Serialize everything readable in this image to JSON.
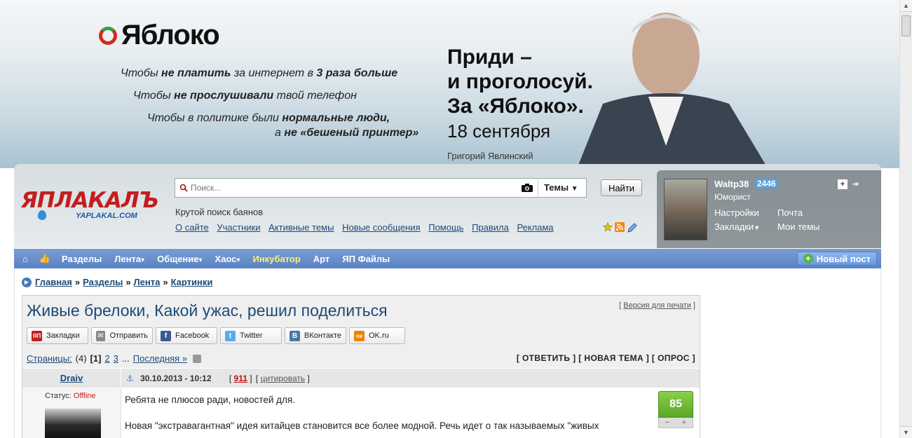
{
  "banner": {
    "brand": "Яблоко",
    "lines": [
      {
        "pre": "Чтобы ",
        "bold": "не платить",
        "mid": " за интернет в ",
        "bold2": "3 раза больше",
        "post": ""
      },
      {
        "pre": "Чтобы ",
        "bold": "не прослушивали",
        "mid": " твой телефон",
        "bold2": "",
        "post": ""
      },
      {
        "pre": "Чтобы в политике были ",
        "bold": "нормальные люди,",
        "mid": "",
        "bold2": "",
        "post": ""
      },
      {
        "pre": "а ",
        "bold": "не «бешеный принтер»",
        "mid": "",
        "bold2": "",
        "post": ""
      }
    ],
    "slogan": [
      "Приди –",
      "и проголосуй.",
      "За «Яблоко»."
    ],
    "date": "18 сентября",
    "author": "Григорий Явлинский"
  },
  "site": {
    "logo_text": "ЯПЛАКАЛЪ",
    "logo_url": "YAPLAKAL.COM"
  },
  "search": {
    "placeholder": "Поиск...",
    "scope": "Темы",
    "button": "Найти",
    "hint": "Крутой поиск баянов"
  },
  "nav_links": [
    "О сайте",
    "Участники",
    "Активные темы",
    "Новые сообщения",
    "Помощь",
    "Правила",
    "Реклама"
  ],
  "profile": {
    "username": "Waltp38",
    "karma": "2446",
    "rank": "Юморист",
    "settings": "Настройки",
    "mail": "Почта",
    "bookmarks": "Закладки",
    "my_topics": "Мои темы"
  },
  "mainnav": {
    "items": [
      {
        "label": "Разделы",
        "arrow": ""
      },
      {
        "label": "Лента",
        "arrow": "▾"
      },
      {
        "label": "Общение",
        "arrow": "▾"
      },
      {
        "label": "Хаос",
        "arrow": "▾"
      },
      {
        "label": "Инкубатор",
        "arrow": ""
      },
      {
        "label": "Арт",
        "arrow": ""
      },
      {
        "label": "ЯП Файлы",
        "arrow": ""
      }
    ],
    "new_post": "Новый пост"
  },
  "breadcrumbs": [
    "Главная",
    "Разделы",
    "Лента",
    "Картинки"
  ],
  "breadcrumb_sep": "»",
  "topic": {
    "title": "Живые брелоки, Какой ужас, решил поделиться",
    "print_link": "Версия для печати"
  },
  "share": [
    {
      "label": "Закладки",
      "icon": "ЯП",
      "color": "#c21e1e"
    },
    {
      "label": "Отправить",
      "icon": "✉",
      "color": "#888888"
    },
    {
      "label": "Facebook",
      "icon": "f",
      "color": "#3b5998"
    },
    {
      "label": "Twitter",
      "icon": "t",
      "color": "#55acee"
    },
    {
      "label": "ВКонтакте",
      "icon": "В",
      "color": "#4a76a8"
    },
    {
      "label": "OK.ru",
      "icon": "ок",
      "color": "#ee8208"
    }
  ],
  "pagination": {
    "label": "Страницы:",
    "count": "(4)",
    "current": "[1]",
    "p2": "2",
    "p3": "3",
    "dots": "...",
    "last": "Последняя »"
  },
  "actions": "[ ОТВЕТИТЬ ] [ НОВАЯ ТЕМА ] [ ОПРОС ]",
  "post": {
    "author": "Draiv",
    "date": "30.10.2013 - 10:12",
    "number": "911",
    "cite": "цитировать",
    "status_label": "Статус:",
    "status_value": "Offline",
    "line1": "Ребята не плюсов ради, новостей для.",
    "line2": "Новая \"экстравагантная\" идея китайцев становится все более модной. Речь идет о так называемых \"живых",
    "rating": "85",
    "minus": "−",
    "plus": "+"
  }
}
